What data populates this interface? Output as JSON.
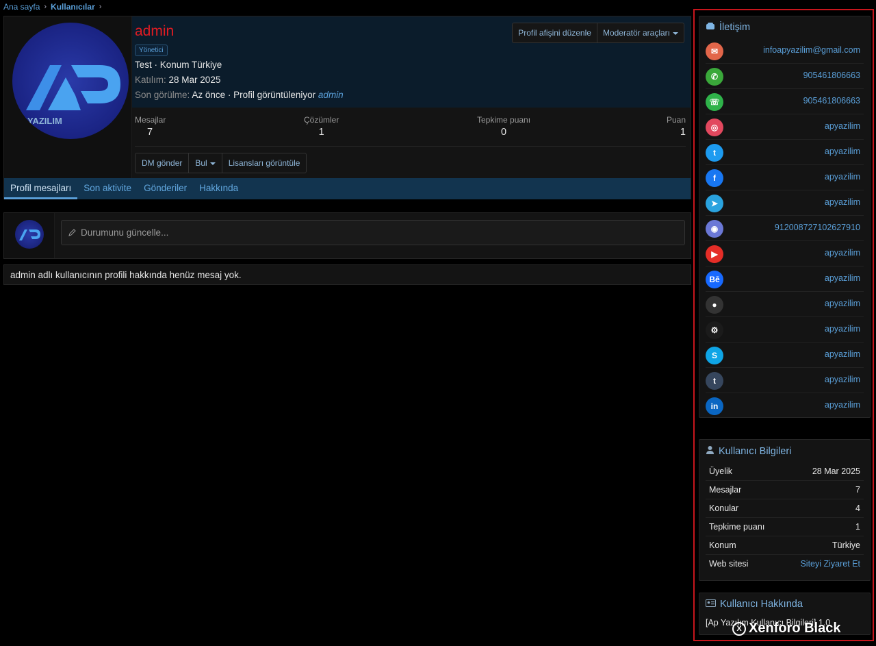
{
  "breadcrumb": {
    "home": "Ana sayfa",
    "users": "Kullanıcılar"
  },
  "profile": {
    "username": "admin",
    "role": "Yönetici",
    "location_line": "Test · Konum Türkiye",
    "joined_label": "Katılım:",
    "joined_value": "28 Mar 2025",
    "last_seen_label": "Son görülme:",
    "last_seen_value": "Az önce · Profil görüntüleniyor",
    "last_seen_user": "admin",
    "avatar_text": "YAZILIM",
    "avatar_mark": "AP",
    "buttons": {
      "edit_banner": "Profil afişini düzenle",
      "mod_tools": "Moderatör araçları"
    },
    "stats": [
      {
        "label": "Mesajlar",
        "value": "7"
      },
      {
        "label": "Çözümler",
        "value": "1"
      },
      {
        "label": "Tepkime puanı",
        "value": "0"
      },
      {
        "label": "Puan",
        "value": "1"
      }
    ],
    "actions": {
      "dm": "DM gönder",
      "find": "Bul",
      "licenses": "Lisansları görüntüle"
    },
    "tabs": [
      "Profil mesajları",
      "Son aktivite",
      "Gönderiler",
      "Hakkında"
    ]
  },
  "status": {
    "placeholder": "Durumunu güncelle..."
  },
  "no_messages": "admin adlı kullanıcının profili hakkında henüz mesaj yok.",
  "sidebar": {
    "contact": {
      "title": "İletişim",
      "items": [
        {
          "icon": "email-icon",
          "color": "#e2664a",
          "glyph": "✉",
          "value": "infoapyazilim@gmail.com"
        },
        {
          "icon": "phone-icon",
          "color": "#3aa83a",
          "glyph": "✆",
          "value": "905461806663"
        },
        {
          "icon": "whatsapp-icon",
          "color": "#2fb34a",
          "glyph": "☏",
          "value": "905461806663"
        },
        {
          "icon": "instagram-icon",
          "color": "#e2485e",
          "glyph": "◎",
          "value": "apyazilim"
        },
        {
          "icon": "twitter-icon",
          "color": "#1d9bf0",
          "glyph": "t",
          "value": "apyazilim"
        },
        {
          "icon": "facebook-icon",
          "color": "#1877f2",
          "glyph": "f",
          "value": "apyazilim"
        },
        {
          "icon": "telegram-icon",
          "color": "#2aa3df",
          "glyph": "➤",
          "value": "apyazilim"
        },
        {
          "icon": "discord-icon",
          "color": "#6b78d6",
          "glyph": "◉",
          "value": "912008727102627910"
        },
        {
          "icon": "youtube-icon",
          "color": "#e52d27",
          "glyph": "▶",
          "value": "apyazilim"
        },
        {
          "icon": "behance-icon",
          "color": "#1769ff",
          "glyph": "Bē",
          "value": "apyazilim"
        },
        {
          "icon": "github-icon",
          "color": "#333333",
          "glyph": "●",
          "value": "apyazilim"
        },
        {
          "icon": "steam-icon",
          "color": "#1b1b1b",
          "glyph": "⚙",
          "value": "apyazilim"
        },
        {
          "icon": "skype-icon",
          "color": "#0fa5e6",
          "glyph": "S",
          "value": "apyazilim"
        },
        {
          "icon": "tumblr-icon",
          "color": "#36465d",
          "glyph": "t",
          "value": "apyazilim"
        },
        {
          "icon": "linkedin-icon",
          "color": "#0a66c2",
          "glyph": "in",
          "value": "apyazilim"
        }
      ]
    },
    "user_info": {
      "title": "Kullanıcı Bilgileri",
      "rows": [
        {
          "label": "Üyelik",
          "value": "28 Mar 2025"
        },
        {
          "label": "Mesajlar",
          "value": "7"
        },
        {
          "label": "Konular",
          "value": "4"
        },
        {
          "label": "Tepkime puanı",
          "value": "1"
        },
        {
          "label": "Konum",
          "value": "Türkiye"
        },
        {
          "label": "Web sitesi",
          "value": "Siteyi Ziyaret Et"
        }
      ]
    },
    "about": {
      "title": "Kullanıcı Hakkında",
      "text": "[Ap Yazılım Kullanıcı Bilgileri] 1.0"
    }
  },
  "watermark": {
    "icon_letter": "X",
    "text": "Xenforo Black"
  }
}
